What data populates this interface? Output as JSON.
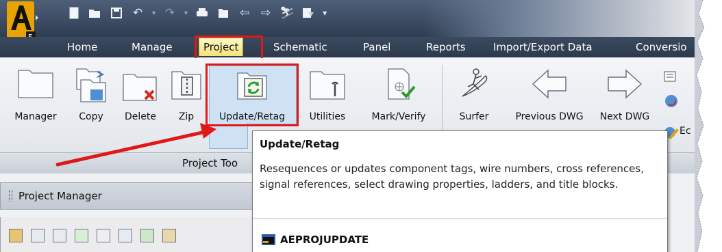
{
  "qat": {
    "icons": [
      "new-icon",
      "open-icon",
      "save-icon",
      "undo-icon",
      "redo-icon",
      "plot-icon",
      "project-icon",
      "back-icon",
      "forward-icon",
      "surfer-icon",
      "customize-icon"
    ]
  },
  "title_partial": "A",
  "tabs": [
    {
      "label": "Home"
    },
    {
      "label": "Manage"
    },
    {
      "label": "Project"
    },
    {
      "label": "Schematic"
    },
    {
      "label": "Panel"
    },
    {
      "label": "Reports"
    },
    {
      "label": "Import/Export Data"
    },
    {
      "label": "Conversio"
    }
  ],
  "ribbon": {
    "buttons": [
      {
        "label": "Manager"
      },
      {
        "label": "Copy"
      },
      {
        "label": "Delete"
      },
      {
        "label": "Zip"
      },
      {
        "label": "Update/Retag"
      },
      {
        "label": "Utilities"
      },
      {
        "label": "Mark/Verify"
      },
      {
        "label": "Surfer"
      },
      {
        "label": "Previous DWG"
      },
      {
        "label": "Next DWG"
      },
      {
        "label": "Ec"
      }
    ],
    "panel_title": "Project Too"
  },
  "project_manager": {
    "title": "Project Manager"
  },
  "tooltip": {
    "title": "Update/Retag",
    "body": "Resequences or updates component tags, wire numbers, cross references, signal references, select drawing properties, ladders, and title blocks.",
    "command": "AEPROJUPDATE"
  },
  "colors": {
    "highlight": "#e01818",
    "active_tab": "#f3e27a"
  }
}
